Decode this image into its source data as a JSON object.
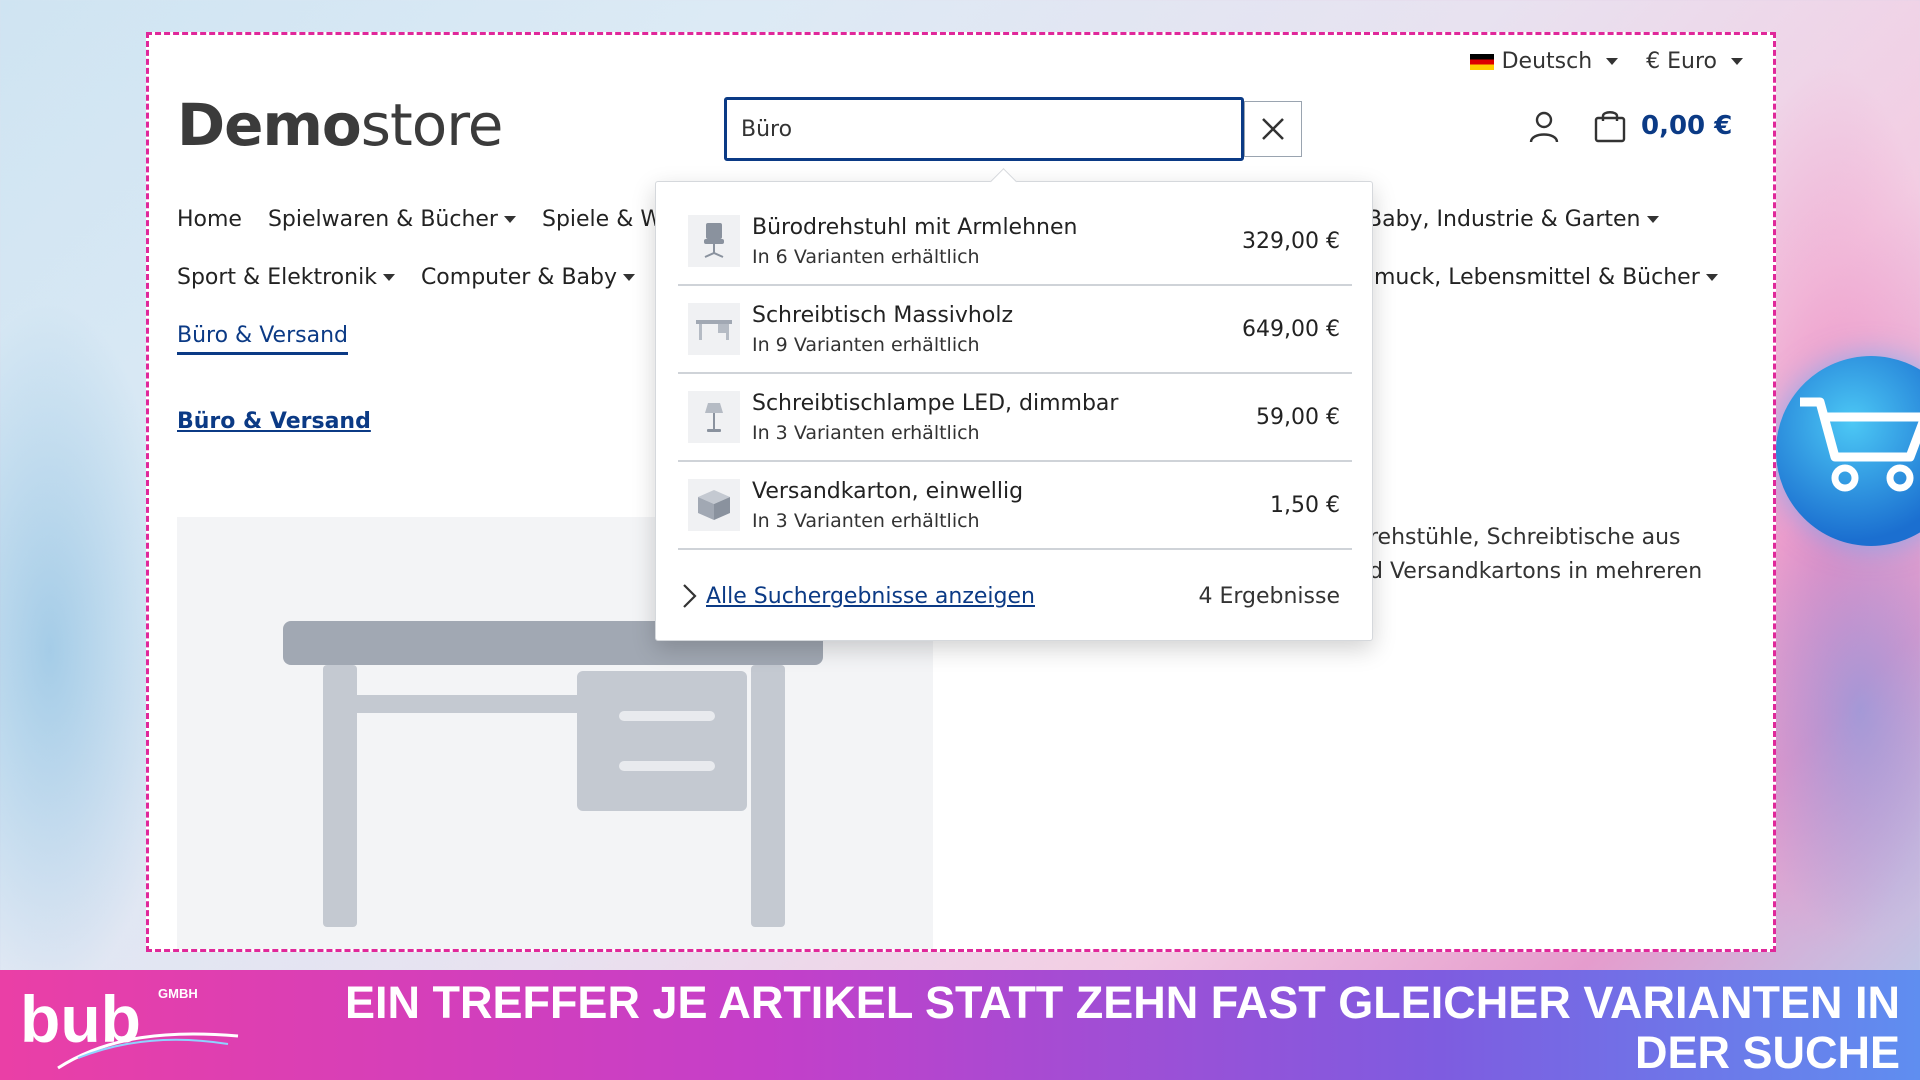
{
  "topbar": {
    "language": "Deutsch",
    "currency": "€ Euro"
  },
  "logo": {
    "bold": "Demo",
    "light": "store"
  },
  "search": {
    "value": "Büro"
  },
  "cart": {
    "total": "0,00 €"
  },
  "nav": {
    "row1": [
      "Home",
      "Spielwaren & Bücher",
      "Spiele & W"
    ],
    "row1_right": "Baby, Industrie & Garten",
    "row2": [
      "Sport & Elektronik",
      "Computer & Baby"
    ],
    "row2_right": "muck, Lebensmittel & Bücher",
    "active": "Büro & Versand"
  },
  "breadcrumb": "Büro & Versand",
  "description": {
    "line1": "rehstühle, Schreibtische aus",
    "line2": "d Versandkartons in mehreren"
  },
  "dropdown": {
    "items": [
      {
        "name": "Bürodrehstuhl mit Armlehnen",
        "variants": "In 6 Varianten erhältlich",
        "price": "329,00 €",
        "icon": "chair-icon"
      },
      {
        "name": "Schreibtisch Massivholz",
        "variants": "In 9 Varianten erhältlich",
        "price": "649,00 €",
        "icon": "desk-icon"
      },
      {
        "name": "Schreibtischlampe LED, dimmbar",
        "variants": "In 3 Varianten erhältlich",
        "price": "59,00 €",
        "icon": "lamp-icon"
      },
      {
        "name": "Versandkarton, einwellig",
        "variants": "In 3 Varianten erhältlich",
        "price": "1,50 €",
        "icon": "box-icon"
      }
    ],
    "all_results": "Alle Suchergebnisse anzeigen",
    "count": "4 Ergebnisse"
  },
  "banner": {
    "logo_text": "bub",
    "logo_sub": "GMBH",
    "headline": "Ein Treffer je Artikel statt zehn fast gleicher Varianten in der Suche"
  },
  "colors": {
    "primary": "#0b3a85",
    "frame_dash": "#e0289a",
    "banner_start": "#ea3fa6",
    "banner_end": "#5f8ef0"
  }
}
